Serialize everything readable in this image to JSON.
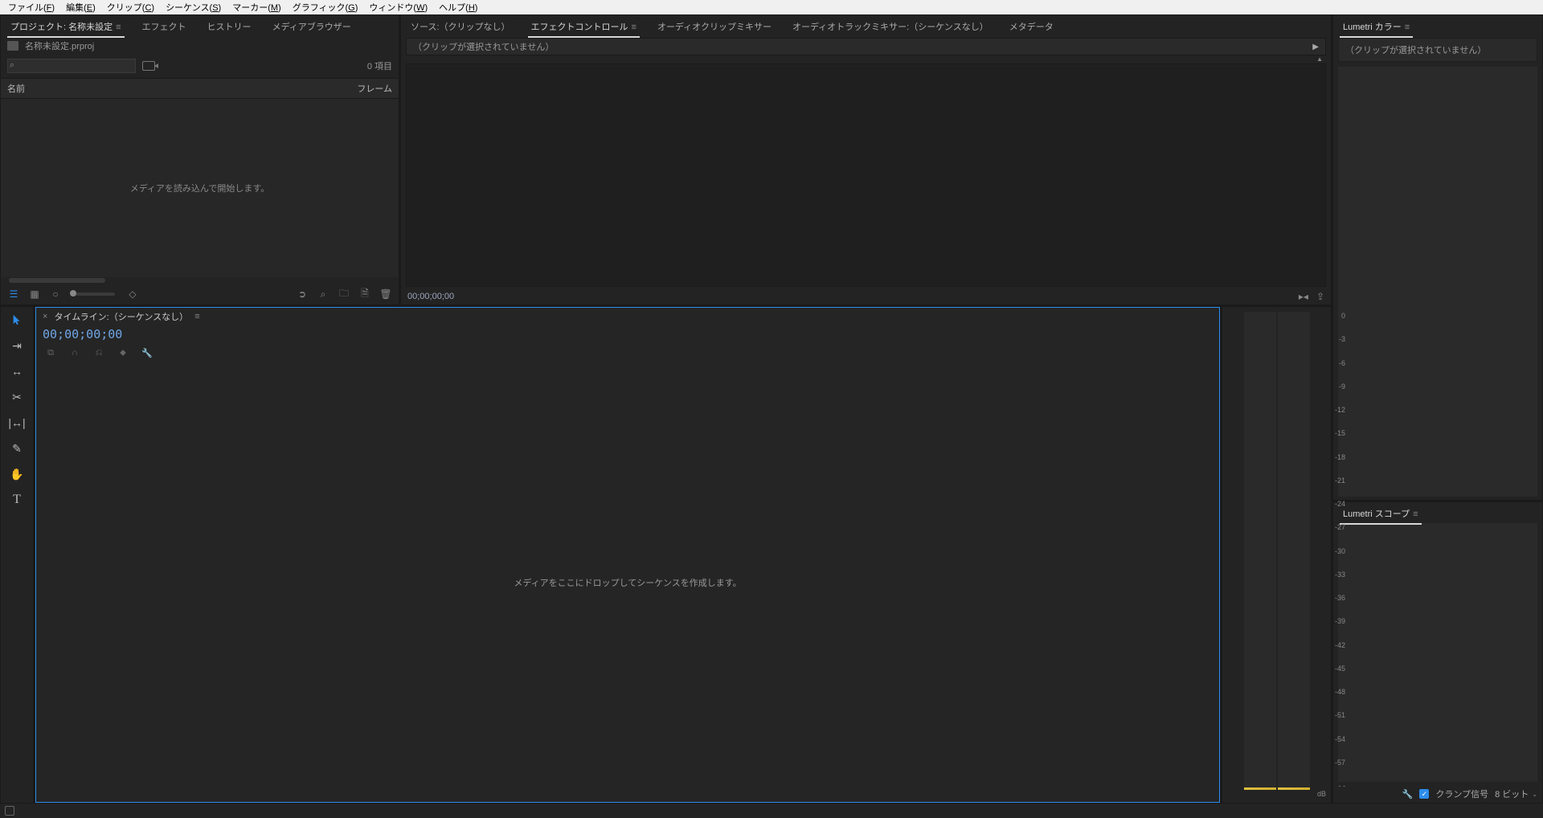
{
  "menu": {
    "file": {
      "label": "ファイル",
      "key": "F"
    },
    "edit": {
      "label": "編集",
      "key": "E"
    },
    "clip": {
      "label": "クリップ",
      "key": "C"
    },
    "sequence": {
      "label": "シーケンス",
      "key": "S"
    },
    "marker": {
      "label": "マーカー",
      "key": "M"
    },
    "graphic": {
      "label": "グラフィック",
      "key": "G"
    },
    "window": {
      "label": "ウィンドウ",
      "key": "W"
    },
    "help": {
      "label": "ヘルプ",
      "key": "H"
    }
  },
  "project": {
    "tabs": {
      "project": {
        "label": "プロジェクト: 名称未設定",
        "hamburger": "≡"
      },
      "effects": {
        "label": "エフェクト"
      },
      "history": {
        "label": "ヒストリー"
      },
      "mediaBrowser": {
        "label": "メディアブラウザー"
      }
    },
    "filename": "名称未設定.prproj",
    "search_placeholder": "",
    "item_count": "0 項目",
    "col_name": "名前",
    "col_frame": "フレーム",
    "empty_msg": "メディアを読み込んで開始します。"
  },
  "source": {
    "tabs": {
      "source": {
        "label": "ソース:（クリップなし）"
      },
      "effectControls": {
        "label": "エフェクトコントロール",
        "hamburger": "≡"
      },
      "audioClipMixer": {
        "label": "オーディオクリップミキサー"
      },
      "audioTrackMixer": {
        "label": "オーディオトラックミキサー:（シーケンスなし）"
      },
      "metadata": {
        "label": "メタデータ"
      }
    },
    "no_clip": "（クリップが選択されていません）",
    "timecode": "00;00;00;00"
  },
  "lumetriColor": {
    "title": "Lumetri カラー",
    "hamburger": "≡",
    "no_clip": "（クリップが選択されていません）"
  },
  "lumetriScopes": {
    "title": "Lumetri スコープ",
    "hamburger": "≡",
    "clamp_label": "クランプ信号",
    "bit_depth": "8 ビット"
  },
  "timeline": {
    "title": "タイムライン:（シーケンスなし）",
    "hamburger": "≡",
    "timecode": "00;00;00;00",
    "drop_msg": "メディアをここにドロップしてシーケンスを作成します。"
  },
  "meters": {
    "ticks": [
      "0",
      "-3",
      "-6",
      "-9",
      "-12",
      "-15",
      "-18",
      "-21",
      "-24",
      "-27",
      "-30",
      "-33",
      "-36",
      "-39",
      "-42",
      "-45",
      "-48",
      "-51",
      "-54",
      "-57",
      "- -"
    ],
    "unit": "dB"
  }
}
